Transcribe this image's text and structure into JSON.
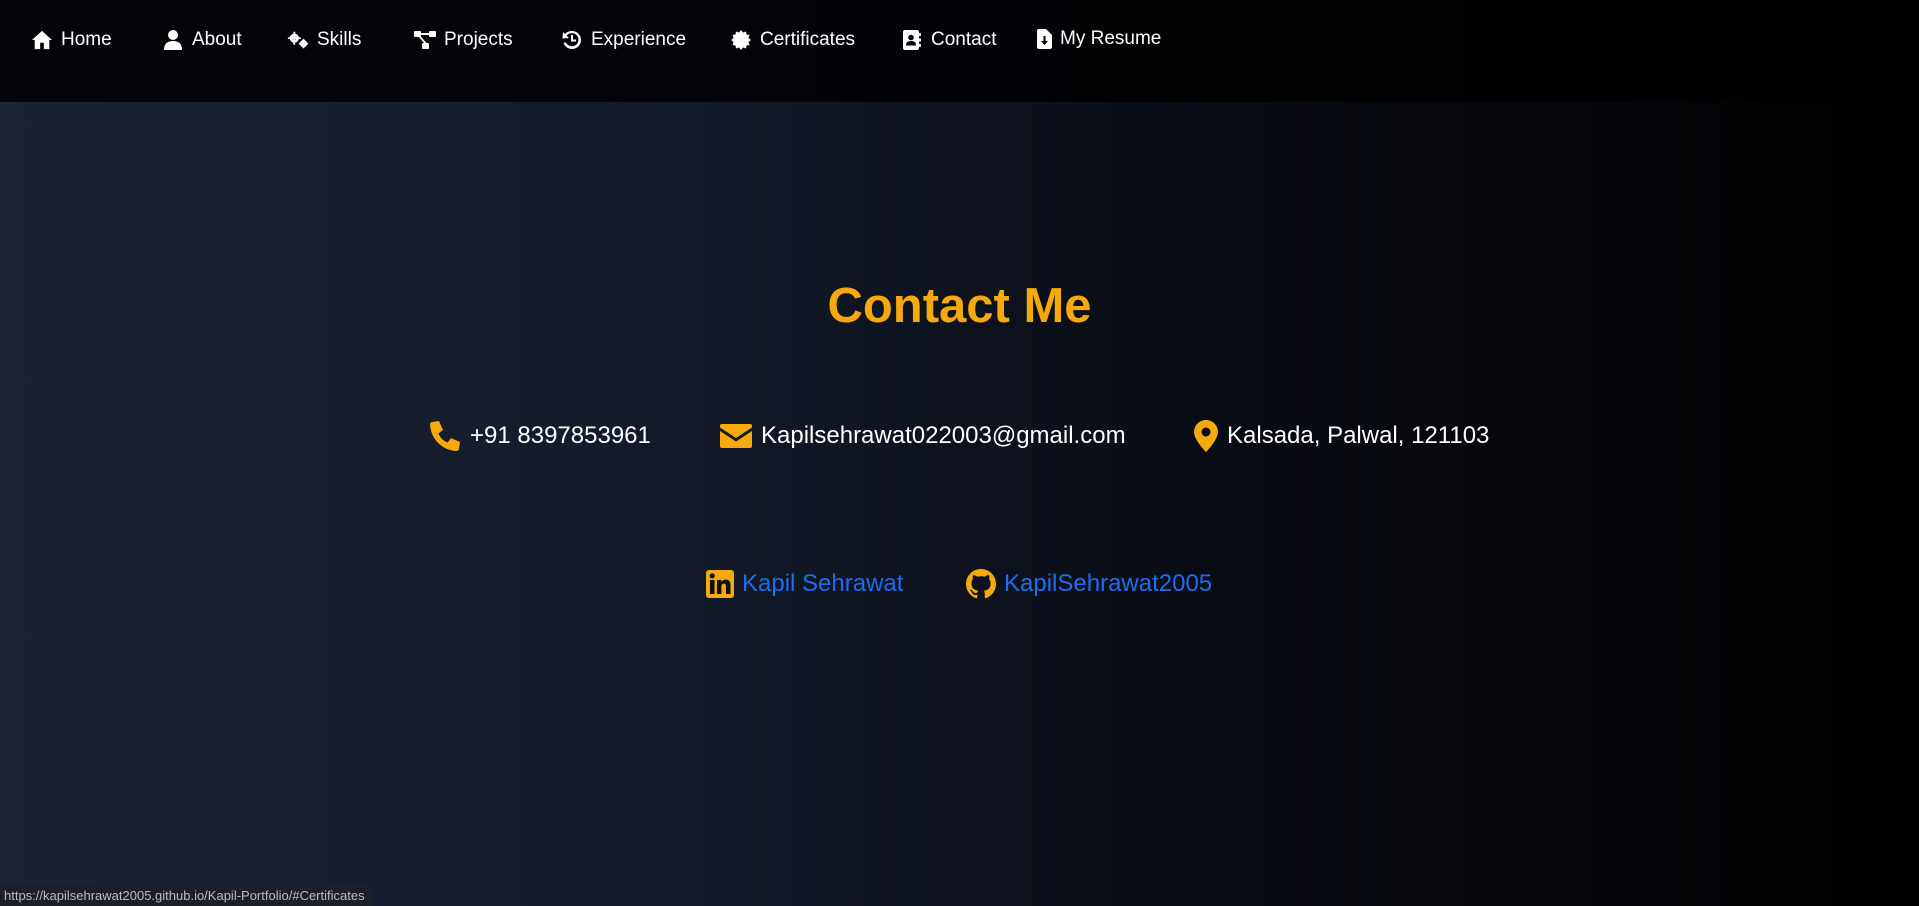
{
  "nav": {
    "items": [
      {
        "label": "Home",
        "icon": "home-icon"
      },
      {
        "label": "About",
        "icon": "user-icon"
      },
      {
        "label": "Skills",
        "icon": "gears-icon"
      },
      {
        "label": "Projects",
        "icon": "diagram-icon"
      },
      {
        "label": "Experience",
        "icon": "history-icon"
      },
      {
        "label": "Certificates",
        "icon": "certificate-icon"
      },
      {
        "label": "Contact",
        "icon": "address-book-icon"
      },
      {
        "label": "My Resume",
        "icon": "file-download-icon"
      }
    ]
  },
  "contact": {
    "title": "Contact Me",
    "phone": "+91 8397853961",
    "email": "Kapilsehrawat022003@gmail.com",
    "location": "Kalsada, Palwal, 121103"
  },
  "social": {
    "linkedin": "Kapil Sehrawat",
    "github": "KapilSehrawat2005"
  },
  "status_bar": {
    "url": "https://kapilsehrawat2005.github.io/Kapil-Portfolio/#Certificates"
  },
  "colors": {
    "accent": "#f5a90d",
    "link": "#1f6cf0",
    "text": "#ffffff"
  }
}
